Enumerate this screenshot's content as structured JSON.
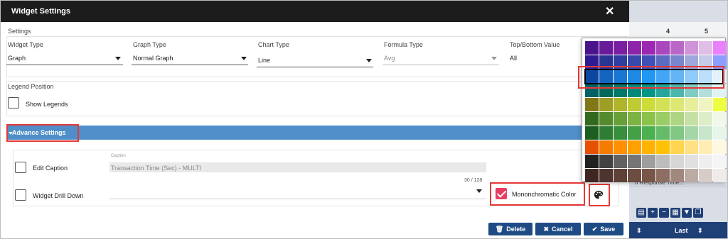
{
  "modal": {
    "title": "Widget Settings",
    "close_label": "✕"
  },
  "settings": {
    "section_label": "Settings",
    "widget_type": {
      "label": "Widget Type",
      "value": "Graph"
    },
    "graph_type": {
      "label": "Graph Type",
      "value": "Normal Graph"
    },
    "chart_type": {
      "label": "Chart Type",
      "value": "Line"
    },
    "formula_type": {
      "label": "Formula Type",
      "value": "Avg"
    },
    "top_bottom": {
      "label": "Top/Bottom Value",
      "value": "All"
    }
  },
  "legend": {
    "section_label": "Legend Position",
    "show_legends_label": "Show Legends",
    "show_legends_checked": false
  },
  "advance": {
    "label": "Advance Settings",
    "edit_caption_label": "Edit Caption",
    "caption_small_label": "Caption",
    "caption_value": "Transaction Time (Sec) - MULTI",
    "counter": "30 / 128",
    "drill_down_label": "Widget Drill Down",
    "monochromatic_label": "Mononchromatic Color",
    "monochromatic_checked": true
  },
  "footer": {
    "delete_label": "Delete",
    "cancel_label": "Cancel",
    "save_label": "Save"
  },
  "background": {
    "col_4": "4",
    "col_5": "5",
    "response_text": "n Response Time...",
    "last_label": "Last"
  },
  "palette": {
    "selected_row": 2,
    "rows": [
      [
        "#4a148c",
        "#6a1b9a",
        "#7b1fa2",
        "#8e24aa",
        "#9c27b0",
        "#ab47bc",
        "#ba68c8",
        "#ce93d8",
        "#e1bee7",
        "#ea80fc"
      ],
      [
        "#311b92",
        "#283593",
        "#303f9f",
        "#3949ab",
        "#3f51b5",
        "#5c6bc0",
        "#7986cb",
        "#9fa8da",
        "#c5cae9",
        "#8c9eff"
      ],
      [
        "#0d47a1",
        "#1565c0",
        "#1976d2",
        "#1e88e5",
        "#2196f3",
        "#42a5f5",
        "#64b5f6",
        "#90caf9",
        "#bbdefb",
        "#e3f2fd"
      ],
      [
        "#006064",
        "#00695c",
        "#00796b",
        "#00897b",
        "#009688",
        "#26a69a",
        "#4db6ac",
        "#80cbc4",
        "#b2dfdb",
        "#e0f2f1"
      ],
      [
        "#827717",
        "#9e9d24",
        "#afb42b",
        "#c0ca33",
        "#cddc39",
        "#d4e157",
        "#dce775",
        "#e6ee9c",
        "#f0f4c3",
        "#eeff41"
      ],
      [
        "#33691e",
        "#558b2f",
        "#689f38",
        "#7cb342",
        "#8bc34a",
        "#9ccc65",
        "#aed581",
        "#c5e1a5",
        "#dcedc8",
        "#f1f8e9"
      ],
      [
        "#1b5e20",
        "#2e7d32",
        "#388e3c",
        "#43a047",
        "#4caf50",
        "#66bb6a",
        "#81c784",
        "#a5d6a7",
        "#c8e6c9",
        "#e8f5e9"
      ],
      [
        "#e65100",
        "#f57c00",
        "#ff8f00",
        "#ffa000",
        "#ffb300",
        "#ffc107",
        "#ffd54f",
        "#ffe082",
        "#ffecb3",
        "#fff8e1"
      ],
      [
        "#212121",
        "#424242",
        "#616161",
        "#757575",
        "#9e9e9e",
        "#bdbdbd",
        "#d6d6d6",
        "#e0e0e0",
        "#eeeeee",
        "#f5f5f5"
      ],
      [
        "#3e2723",
        "#4e342e",
        "#5d4037",
        "#6d4c41",
        "#795548",
        "#8d6e63",
        "#a1887f",
        "#bcaaa4",
        "#d7ccc8",
        "#efebe9"
      ]
    ]
  },
  "colors": {
    "header_bg": "#1c1c1c",
    "advance_bar": "#4f8ec9",
    "button_bg": "#1f4b85",
    "highlight_red": "#e53935",
    "checkbox_pink": "#e83e62"
  },
  "icons": {
    "close": "close-icon",
    "caret": "caret-down-icon",
    "delete": "trash-icon",
    "cancel": "x-icon",
    "save": "check-icon",
    "palette": "palette-icon"
  }
}
